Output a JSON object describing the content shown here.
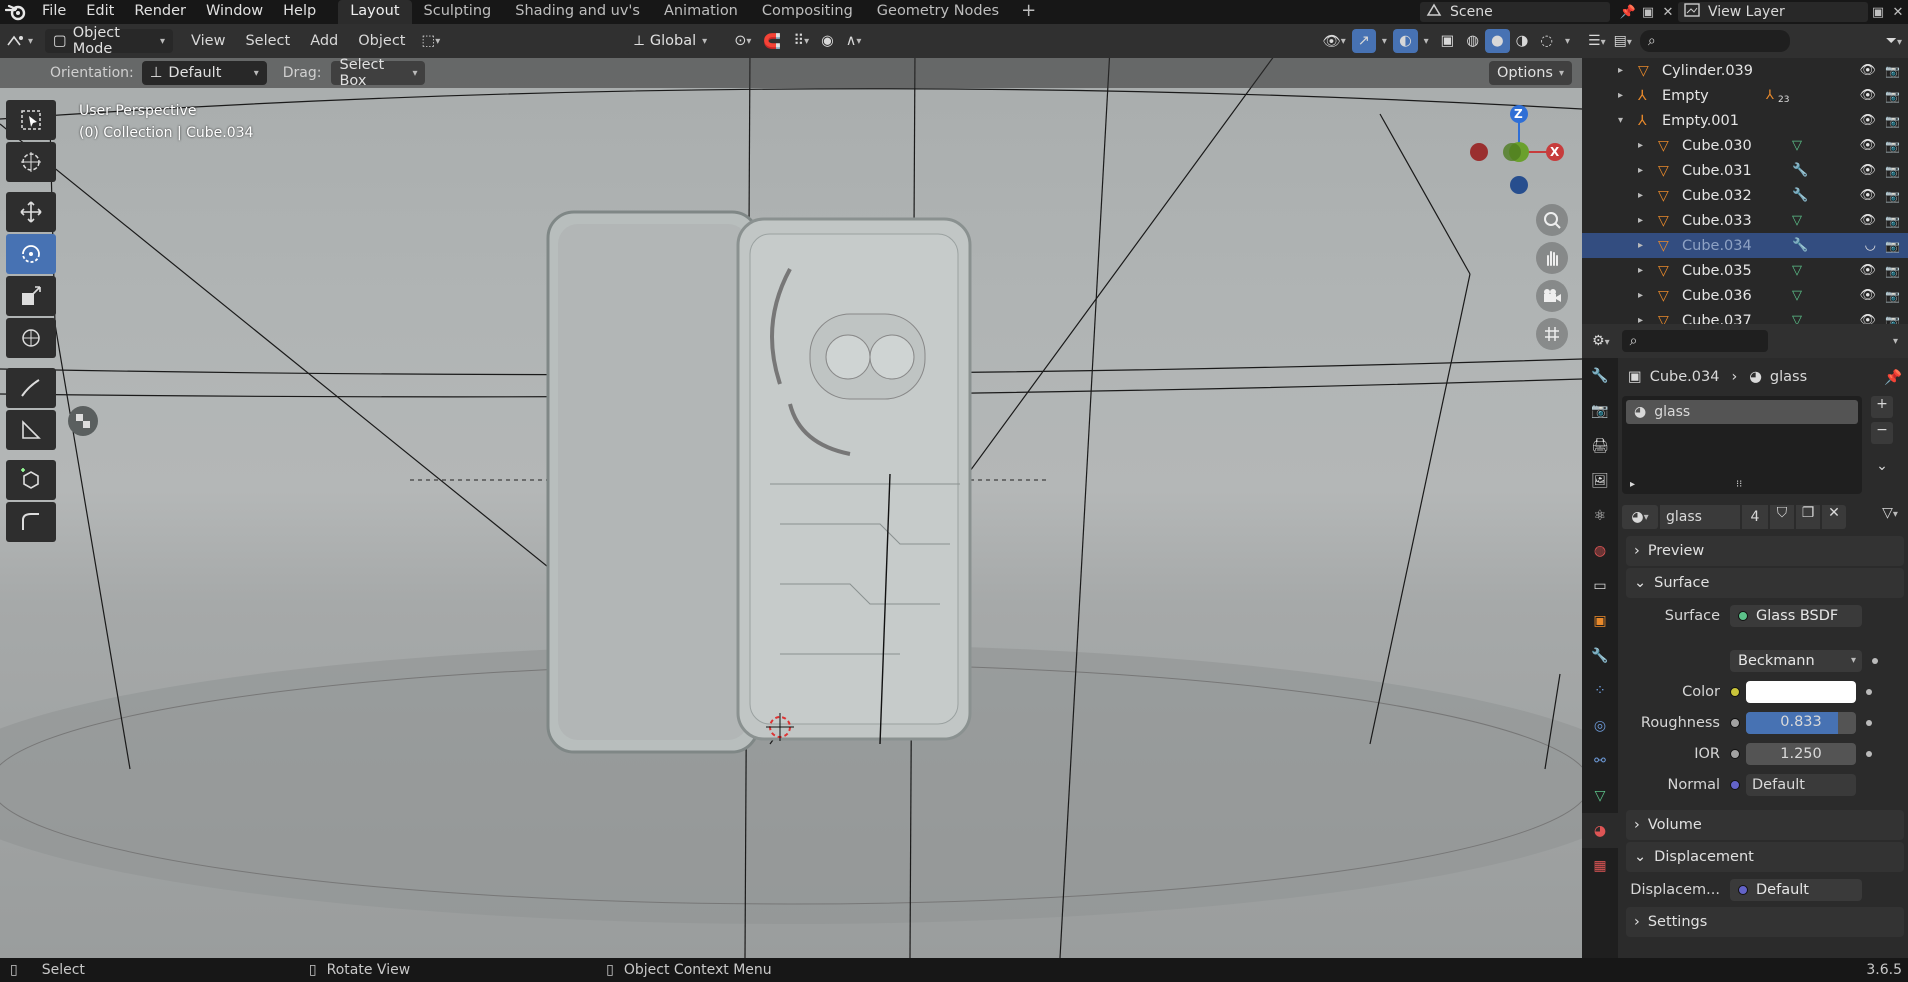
{
  "menus": [
    "File",
    "Edit",
    "Render",
    "Window",
    "Help"
  ],
  "workspaces": [
    "Layout",
    "Sculpting",
    "Shading and uv's",
    "Animation",
    "Compositing",
    "Geometry Nodes"
  ],
  "active_workspace": "Layout",
  "scene_name": "Scene",
  "view_layer": "View Layer",
  "viewport": {
    "mode": "Object Mode",
    "menus": [
      "View",
      "Select",
      "Add",
      "Object"
    ],
    "transform_orientation": "Global",
    "orientation_label": "Orientation:",
    "orientation_value": "Default",
    "drag_label": "Drag:",
    "drag_value": "Select Box",
    "options_label": "Options",
    "perspective_text": "User Perspective",
    "collection_text": "(0) Collection | Cube.034",
    "gizmo": {
      "z": "Z",
      "x": "X"
    }
  },
  "outliner": {
    "rows": [
      {
        "name": "Cylinder.039",
        "type": "mesh",
        "indent": 1
      },
      {
        "name": "Empty",
        "type": "empty",
        "indent": 1,
        "badge": "23"
      },
      {
        "name": "Empty.001",
        "type": "empty",
        "indent": 1,
        "expanded": true
      },
      {
        "name": "Cube.030",
        "type": "mesh",
        "indent": 2,
        "mod": "mesh"
      },
      {
        "name": "Cube.031",
        "type": "mesh",
        "indent": 2,
        "mod": "wrench"
      },
      {
        "name": "Cube.032",
        "type": "mesh",
        "indent": 2,
        "mod": "wrench"
      },
      {
        "name": "Cube.033",
        "type": "mesh",
        "indent": 2,
        "mod": "mesh"
      },
      {
        "name": "Cube.034",
        "type": "mesh",
        "indent": 2,
        "mod": "wrench",
        "selected": true
      },
      {
        "name": "Cube.035",
        "type": "mesh",
        "indent": 2,
        "mod": "mesh"
      },
      {
        "name": "Cube.036",
        "type": "mesh",
        "indent": 2,
        "mod": "mesh"
      },
      {
        "name": "Cube.037",
        "type": "mesh",
        "indent": 2,
        "mod": "mesh"
      }
    ]
  },
  "properties": {
    "breadcrumb_object": "Cube.034",
    "breadcrumb_material": "glass",
    "slot_name": "glass",
    "material_name": "glass",
    "users": "4",
    "panels": {
      "preview": "Preview",
      "surface": "Surface",
      "volume": "Volume",
      "displacement": "Displacement",
      "settings": "Settings"
    },
    "surface": {
      "label": "Surface",
      "shader": "Glass BSDF",
      "distribution": "Beckmann",
      "color_label": "Color",
      "color_value": "#ffffff",
      "roughness_label": "Roughness",
      "roughness": "0.833",
      "roughness_fraction": 0.833,
      "ior_label": "IOR",
      "ior": "1.250",
      "normal_label": "Normal",
      "normal": "Default"
    },
    "displacement": {
      "label": "Displacem...",
      "value": "Default"
    }
  },
  "statusbar": {
    "select": "Select",
    "rotate": "Rotate View",
    "context": "Object Context Menu",
    "version": "3.6.5"
  },
  "colors": {
    "accent": "#4772b3",
    "selected_row": "#334d80",
    "axis_x": "#c73c3c",
    "axis_y": "#6aa02c",
    "axis_z": "#2f6fd6"
  }
}
